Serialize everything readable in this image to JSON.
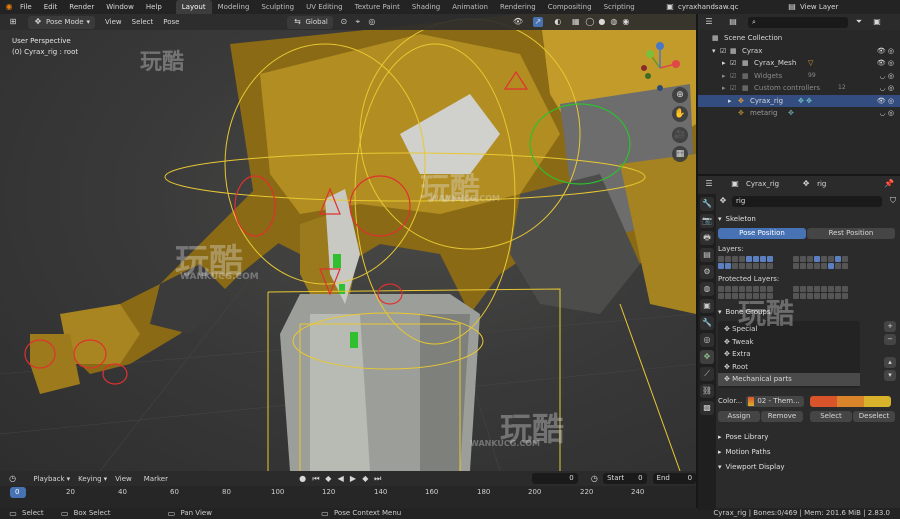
{
  "topbar": {
    "menu": [
      "File",
      "Edit",
      "Render",
      "Window",
      "Help"
    ],
    "workspaces": [
      "Layout",
      "Modeling",
      "Sculpting",
      "UV Editing",
      "Texture Paint",
      "Shading",
      "Animation",
      "Rendering",
      "Compositing",
      "Scripting"
    ],
    "active_workspace": "Layout",
    "file_name": "cyraxhandsaw.qc",
    "view_layer": "View Layer"
  },
  "viewport_header": {
    "mode": "Pose Mode",
    "menus": [
      "View",
      "Select",
      "Pose"
    ],
    "transform_orientation": "Global"
  },
  "viewport": {
    "perspective": "User Perspective",
    "object_info": "(0) Cyrax_rig : root"
  },
  "watermark": {
    "cn": "玩酷",
    "url": "WANKUCG.COM"
  },
  "outliner": {
    "search_placeholder": "",
    "rows": [
      {
        "label": "Scene Collection",
        "indent": 0
      },
      {
        "label": "Cyrax",
        "indent": 1
      },
      {
        "label": "Cyrax_Mesh",
        "indent": 2
      },
      {
        "label": "Widgets",
        "indent": 2,
        "badge": "99"
      },
      {
        "label": "Custom controllers",
        "indent": 2,
        "badge": "12"
      },
      {
        "label": "Cyrax_rig",
        "indent": 2,
        "selected": true
      },
      {
        "label": "metarig",
        "indent": 2
      }
    ]
  },
  "properties": {
    "object_name": "Cyrax_rig",
    "data_name": "rig",
    "datablock": "rig",
    "skeleton_label": "Skeleton",
    "pose_position": "Pose Position",
    "rest_position": "Rest Position",
    "layers_label": "Layers:",
    "protected_layers_label": "Protected Layers:",
    "bone_groups_label": "Bone Groups",
    "bone_groups": [
      "Special",
      "Tweak",
      "Extra",
      "Root",
      "Mechanical parts"
    ],
    "selected_bone_group": "Mechanical parts",
    "color_label": "Color...",
    "color_set": "02 - Them...",
    "swatch_colors": [
      "#d9532b",
      "#d9832b",
      "#d9b22b"
    ],
    "assign": "Assign",
    "remove": "Remove",
    "select": "Select",
    "deselect": "Deselect",
    "pose_library": "Pose Library",
    "motion_paths": "Motion Paths",
    "viewport_display": "Viewport Display"
  },
  "timeline": {
    "menus": [
      "Playback",
      "Keying",
      "View",
      "Marker"
    ],
    "current_frame": "0",
    "start_label": "Start",
    "start": "0",
    "end_label": "End",
    "end": "0",
    "ticks": [
      "0",
      "20",
      "40",
      "60",
      "80",
      "100",
      "120",
      "140",
      "160",
      "180",
      "200",
      "220",
      "240"
    ]
  },
  "status": {
    "select": "Select",
    "box_select": "Box Select",
    "pan_view": "Pan View",
    "context_menu": "Pose Context Menu",
    "stats": "Cyrax_rig | Bones:0/469 | Mem: 201.6 MiB | 2.83.0"
  },
  "colors": {
    "accent": "#4772b3",
    "bone_yellow": "#e8c832",
    "bone_red": "#e03030"
  }
}
